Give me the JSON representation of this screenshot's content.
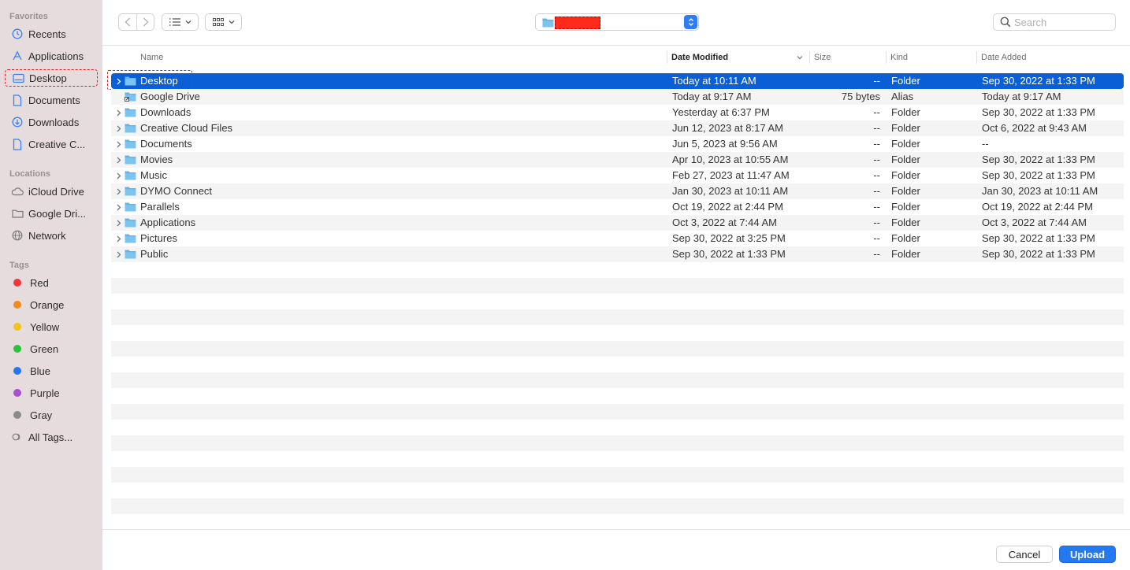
{
  "sidebar": {
    "favorites_title": "Favorites",
    "favorites": [
      {
        "label": "Recents",
        "icon": "clock-icon"
      },
      {
        "label": "Applications",
        "icon": "applications-icon"
      },
      {
        "label": "Desktop",
        "icon": "desktop-icon"
      },
      {
        "label": "Documents",
        "icon": "document-icon"
      },
      {
        "label": "Downloads",
        "icon": "download-icon"
      },
      {
        "label": "Creative C...",
        "icon": "document-icon"
      }
    ],
    "locations_title": "Locations",
    "locations": [
      {
        "label": "iCloud Drive",
        "icon": "cloud-icon"
      },
      {
        "label": "Google Dri...",
        "icon": "folder-icon"
      },
      {
        "label": "Network",
        "icon": "globe-icon"
      }
    ],
    "tags_title": "Tags",
    "tags": [
      {
        "label": "Red",
        "color": "#f0383a"
      },
      {
        "label": "Orange",
        "color": "#f28a1c"
      },
      {
        "label": "Yellow",
        "color": "#f2c31c"
      },
      {
        "label": "Green",
        "color": "#2cc23a"
      },
      {
        "label": "Blue",
        "color": "#2676f0"
      },
      {
        "label": "Purple",
        "color": "#a64fd1"
      },
      {
        "label": "Gray",
        "color": "#8b8b8d"
      }
    ],
    "all_tags": "All Tags..."
  },
  "toolbar": {
    "back_icon": "chevron-left-icon",
    "forward_icon": "chevron-right-icon",
    "search_placeholder": "Search"
  },
  "columns": {
    "name": "Name",
    "date_modified": "Date Modified",
    "size": "Size",
    "kind": "Kind",
    "date_added": "Date Added"
  },
  "files": [
    {
      "name": "Desktop",
      "date_modified": "Today at 10:11 AM",
      "size": "--",
      "kind": "Folder",
      "date_added": "Sep 30, 2022 at 1:33 PM",
      "expandable": true,
      "selected": true
    },
    {
      "name": "Google Drive",
      "date_modified": "Today at 9:17 AM",
      "size": "75 bytes",
      "kind": "Alias",
      "date_added": "Today at 9:17 AM",
      "expandable": false
    },
    {
      "name": "Downloads",
      "date_modified": "Yesterday at 6:37 PM",
      "size": "--",
      "kind": "Folder",
      "date_added": "Sep 30, 2022 at 1:33 PM",
      "expandable": true
    },
    {
      "name": "Creative Cloud Files",
      "date_modified": "Jun 12, 2023 at 8:17 AM",
      "size": "--",
      "kind": "Folder",
      "date_added": "Oct 6, 2022 at 9:43 AM",
      "expandable": true
    },
    {
      "name": "Documents",
      "date_modified": "Jun 5, 2023 at 9:56 AM",
      "size": "--",
      "kind": "Folder",
      "date_added": "--",
      "expandable": true
    },
    {
      "name": "Movies",
      "date_modified": "Apr 10, 2023 at 10:55 AM",
      "size": "--",
      "kind": "Folder",
      "date_added": "Sep 30, 2022 at 1:33 PM",
      "expandable": true
    },
    {
      "name": "Music",
      "date_modified": "Feb 27, 2023 at 11:47 AM",
      "size": "--",
      "kind": "Folder",
      "date_added": "Sep 30, 2022 at 1:33 PM",
      "expandable": true
    },
    {
      "name": "DYMO Connect",
      "date_modified": "Jan 30, 2023 at 10:11 AM",
      "size": "--",
      "kind": "Folder",
      "date_added": "Jan 30, 2023 at 10:11 AM",
      "expandable": true
    },
    {
      "name": "Parallels",
      "date_modified": "Oct 19, 2022 at 2:44 PM",
      "size": "--",
      "kind": "Folder",
      "date_added": "Oct 19, 2022 at 2:44 PM",
      "expandable": true
    },
    {
      "name": "Applications",
      "date_modified": "Oct 3, 2022 at 7:44 AM",
      "size": "--",
      "kind": "Folder",
      "date_added": "Oct 3, 2022 at 7:44 AM",
      "expandable": true
    },
    {
      "name": "Pictures",
      "date_modified": "Sep 30, 2022 at 3:25 PM",
      "size": "--",
      "kind": "Folder",
      "date_added": "Sep 30, 2022 at 1:33 PM",
      "expandable": true
    },
    {
      "name": "Public",
      "date_modified": "Sep 30, 2022 at 1:33 PM",
      "size": "--",
      "kind": "Folder",
      "date_added": "Sep 30, 2022 at 1:33 PM",
      "expandable": true
    }
  ],
  "footer": {
    "cancel_label": "Cancel",
    "upload_label": "Upload"
  },
  "colors": {
    "accent": "#0a5ed6",
    "sidebar_bg": "#e6dcdd",
    "folder": "#5fb4ea"
  }
}
